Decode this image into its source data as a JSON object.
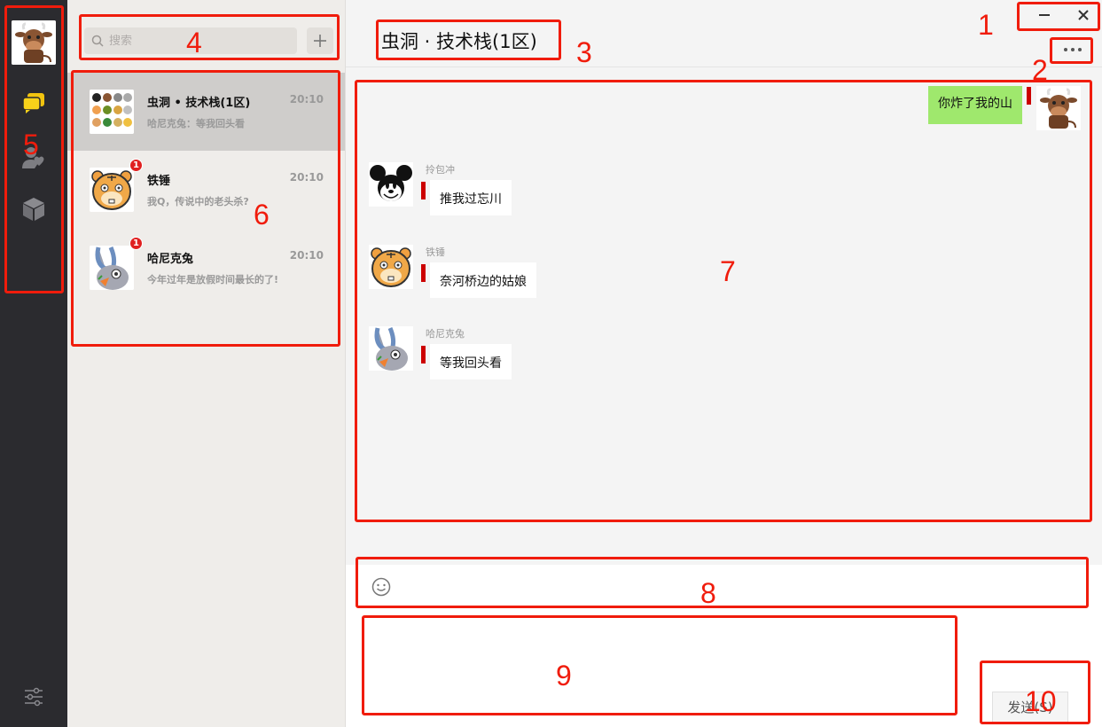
{
  "nav": {
    "me_avatar": "cow-avatar",
    "items": [
      {
        "icon": "chat-icon",
        "active": true
      },
      {
        "icon": "contacts-icon",
        "active": false
      },
      {
        "icon": "box-icon",
        "active": false
      }
    ],
    "settings_icon": "settings-sliders-icon"
  },
  "search": {
    "placeholder": "搜索"
  },
  "conversations": [
    {
      "name": "虫洞 • 技术栈(1区)",
      "time": "20:10",
      "preview": "哈尼克兔：等我回头看",
      "unread": "",
      "active": true,
      "avatar": "animal-grid-avatar"
    },
    {
      "name": "铁锤",
      "time": "20:10",
      "preview": "我Q，传说中的老头杀?",
      "unread": "1",
      "active": false,
      "avatar": "tiger-avatar"
    },
    {
      "name": "哈尼克兔",
      "time": "20:10",
      "preview": "今年过年是放假时间最长的了!",
      "unread": "1",
      "active": false,
      "avatar": "rabbit-avatar"
    }
  ],
  "chat": {
    "title": "虫洞 · 技术栈(1区)",
    "messages": [
      {
        "direction": "out",
        "text": "你炸了我的山",
        "avatar": "cow-avatar"
      },
      {
        "direction": "in",
        "sender": "拎包冲",
        "text": "推我过忘川",
        "avatar": "mickey-avatar"
      },
      {
        "direction": "in",
        "sender": "铁锤",
        "text": "奈河桥边的姑娘",
        "avatar": "tiger-avatar"
      },
      {
        "direction": "in",
        "sender": "哈尼克兔",
        "text": "等我回头看",
        "avatar": "rabbit-avatar"
      }
    ],
    "send_label": "发送(S)"
  },
  "annotations": [
    "1",
    "2",
    "3",
    "4",
    "5",
    "6",
    "7",
    "8",
    "9",
    "10"
  ],
  "colors": {
    "annotation": "#f01c0c",
    "out_bubble": "#9fe86d",
    "nav_bg": "#2b2b2f",
    "unread": "#e02020"
  }
}
